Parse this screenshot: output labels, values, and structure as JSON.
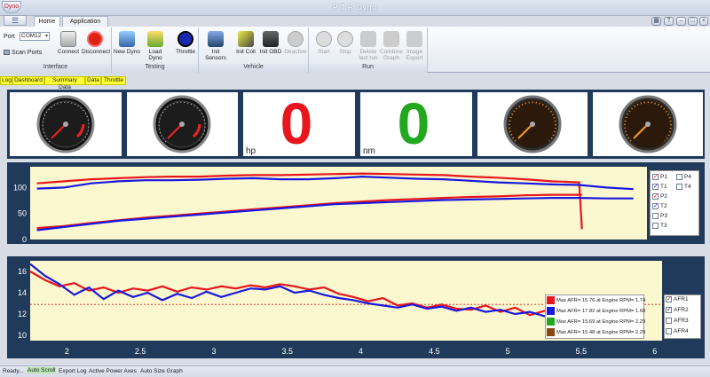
{
  "window": {
    "title": "P.T.R Dyno",
    "app_icon": "Dyno"
  },
  "tabs": [
    {
      "label": "Home",
      "active": true
    },
    {
      "label": "Application",
      "active": false
    }
  ],
  "ribbon": {
    "port_label": "Port",
    "port_value": "COM12",
    "scan_ports": "Scan Ports",
    "connect": "Connect",
    "disconnect": "Disconnect",
    "new_dyno": "New Dyno",
    "load_dyno": "Load Dyno",
    "throttle": "Throttle",
    "init_sensors": "Init Sensors",
    "init_coil": "Init Coil",
    "init_obd": "Init OBD",
    "deactive": "Deactive",
    "start": "Start",
    "stop": "Stop",
    "delete_last_run_1": "Delete",
    "delete_last_run_2": "last run",
    "combine_graph_1": "Combine",
    "combine_graph_2": "Graph",
    "image_export_1": "Image",
    "image_export_2": "Export",
    "groups": {
      "interface": "Interface",
      "testing": "Testing",
      "vehicle": "Vehicle",
      "run": "Run"
    }
  },
  "view_tabs": [
    "Log",
    "Dashboard",
    "Summary Data",
    "Data",
    "Throttle"
  ],
  "readouts": {
    "hp_value": "0",
    "hp_unit": "hp",
    "nm_value": "0",
    "nm_unit": "nm"
  },
  "colors": {
    "hp_value": "#e8161c",
    "nm_value": "#22a81f",
    "series_p": "#e8161c",
    "series_t": "#1818e0"
  },
  "top_chart_legend": {
    "col1": [
      {
        "label": "P1",
        "checked": true
      },
      {
        "label": "T1",
        "checked": true
      },
      {
        "label": "P2",
        "checked": true
      },
      {
        "label": "T2",
        "checked": true
      },
      {
        "label": "P3",
        "checked": false
      },
      {
        "label": "T3",
        "checked": false
      }
    ],
    "col2": [
      {
        "label": "P4",
        "checked": false
      },
      {
        "label": "T4",
        "checked": false
      }
    ]
  },
  "afr_legend": [
    {
      "text": "Max AFR= 15.76 at Engine RPM= 1.74",
      "color": "#e8161c"
    },
    {
      "text": "Max AFR= 17.82 at Engine RPM= 1.68",
      "color": "#1818e0"
    },
    {
      "text": "Max AFR= 15.69 at Engine RPM= 2.29",
      "color": "#22a81f"
    },
    {
      "text": "Max AFR= 15.48 at Engine RPM= 2.29",
      "color": "#8b4513"
    }
  ],
  "afr_checks": [
    {
      "label": "AFR1",
      "checked": true
    },
    {
      "label": "AFR2",
      "checked": true
    },
    {
      "label": "AFR3",
      "checked": false
    },
    {
      "label": "AFR4",
      "checked": false
    }
  ],
  "chart_data": [
    {
      "type": "line",
      "ylim": [
        0,
        140
      ],
      "y_ticks": [
        "0",
        "50",
        "100"
      ],
      "series": [
        {
          "name": "P1",
          "color": "#e8161c",
          "x": [
            1.6,
            1.8,
            2.0,
            2.2,
            2.4,
            2.6,
            2.8,
            3.0,
            3.2,
            3.4,
            3.6,
            3.8,
            4.0,
            4.2,
            4.4,
            4.6,
            4.8,
            5.0,
            5.2,
            5.4,
            5.6,
            5.62
          ],
          "values": [
            108,
            112,
            116,
            118,
            120,
            121,
            121,
            123,
            124,
            124,
            125,
            126,
            127,
            126,
            125,
            124,
            121,
            119,
            116,
            112,
            110,
            20
          ]
        },
        {
          "name": "T1",
          "color": "#e8161c",
          "x": [
            1.6,
            1.8,
            2.0,
            2.2,
            2.4,
            2.6,
            2.8,
            3.0,
            3.2,
            3.4,
            3.6,
            3.8,
            4.0,
            4.2,
            4.4,
            4.6,
            4.8,
            5.0,
            5.2,
            5.4,
            5.6,
            5.62
          ],
          "values": [
            22,
            26,
            32,
            37,
            42,
            46,
            50,
            54,
            58,
            62,
            66,
            70,
            73,
            76,
            78,
            80,
            82,
            83,
            85,
            86,
            86,
            86
          ]
        },
        {
          "name": "P2",
          "color": "#1818e0",
          "x": [
            1.6,
            1.8,
            2.0,
            2.2,
            2.4,
            2.6,
            2.8,
            3.0,
            3.2,
            3.4,
            3.6,
            3.8,
            4.0,
            4.2,
            4.4,
            4.6,
            4.8,
            5.0,
            5.2,
            5.4,
            5.6,
            5.8,
            6.0
          ],
          "values": [
            98,
            100,
            108,
            112,
            114,
            114,
            115,
            117,
            118,
            116,
            116,
            118,
            121,
            119,
            117,
            116,
            113,
            110,
            108,
            106,
            105,
            100,
            97
          ]
        },
        {
          "name": "T2",
          "color": "#1818e0",
          "x": [
            1.6,
            1.8,
            2.0,
            2.2,
            2.4,
            2.6,
            2.8,
            3.0,
            3.2,
            3.4,
            3.6,
            3.8,
            4.0,
            4.2,
            4.4,
            4.6,
            4.8,
            5.0,
            5.2,
            5.4,
            5.6,
            5.8,
            6.0
          ],
          "values": [
            18,
            24,
            30,
            36,
            40,
            44,
            48,
            52,
            56,
            60,
            64,
            68,
            70,
            72,
            74,
            76,
            77,
            78,
            79,
            80,
            80,
            79,
            79
          ]
        }
      ]
    },
    {
      "type": "line",
      "xlim": [
        1.75,
        6.05
      ],
      "ylim": [
        9.5,
        17
      ],
      "x_ticks": [
        "2",
        "2.5",
        "3",
        "3.5",
        "4",
        "4.5",
        "5",
        "5.5",
        "6"
      ],
      "y_ticks": [
        "10",
        "12",
        "14",
        "16"
      ],
      "reference_line": 12.9,
      "series": [
        {
          "name": "AFR1",
          "color": "#e8161c",
          "x": [
            1.75,
            1.85,
            1.95,
            2.05,
            2.15,
            2.25,
            2.35,
            2.45,
            2.55,
            2.65,
            2.75,
            2.85,
            2.95,
            3.05,
            3.15,
            3.25,
            3.35,
            3.45,
            3.55,
            3.65,
            3.75,
            3.85,
            3.95,
            4.05,
            4.15,
            4.25,
            4.35,
            4.45,
            4.55,
            4.65,
            4.75,
            4.85,
            4.95,
            5.05,
            5.15,
            5.25,
            5.35,
            5.45,
            5.55
          ],
          "values": [
            16.0,
            15.2,
            14.6,
            14.9,
            14.2,
            14.5,
            14.0,
            14.4,
            14.2,
            14.6,
            14.1,
            14.5,
            14.3,
            14.6,
            14.4,
            14.7,
            14.5,
            14.8,
            14.6,
            14.3,
            14.5,
            13.9,
            13.6,
            13.2,
            13.5,
            12.8,
            13.0,
            12.6,
            12.9,
            12.5,
            12.4,
            12.8,
            12.2,
            12.6,
            11.9,
            12.3,
            11.8,
            11.6,
            11.5
          ]
        },
        {
          "name": "AFR2",
          "color": "#1818e0",
          "x": [
            1.75,
            1.85,
            1.95,
            2.05,
            2.15,
            2.25,
            2.35,
            2.45,
            2.55,
            2.65,
            2.75,
            2.85,
            2.95,
            3.05,
            3.15,
            3.25,
            3.35,
            3.45,
            3.55,
            3.65,
            3.75,
            3.85,
            3.95,
            4.05,
            4.15,
            4.25,
            4.35,
            4.45,
            4.55,
            4.65,
            4.75,
            4.85,
            4.95,
            5.05,
            5.15,
            5.25,
            5.35,
            5.45,
            5.55
          ],
          "values": [
            16.7,
            15.6,
            14.8,
            13.8,
            14.5,
            13.4,
            14.2,
            13.6,
            14.0,
            13.3,
            13.9,
            13.5,
            14.1,
            13.6,
            14.0,
            14.4,
            14.3,
            14.6,
            14.0,
            14.2,
            13.8,
            13.5,
            13.3,
            13.0,
            12.8,
            12.6,
            12.9,
            12.5,
            12.7,
            12.3,
            12.6,
            12.2,
            12.4,
            12.0,
            12.2,
            11.8,
            11.6,
            11.4,
            11.3
          ]
        }
      ]
    }
  ]
}
